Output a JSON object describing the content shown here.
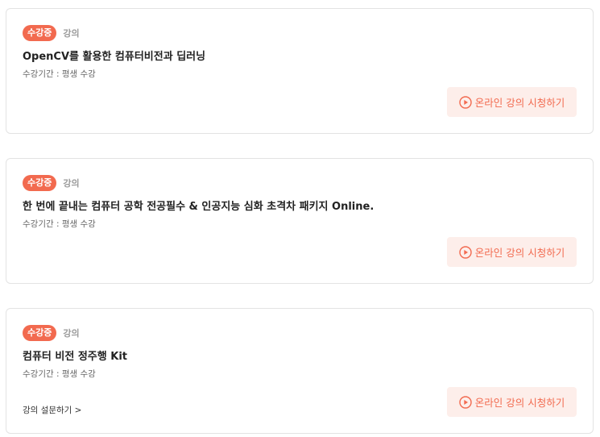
{
  "courses": [
    {
      "badge": "수강중",
      "type": "강의",
      "title": "OpenCV를 활용한 컴퓨터비전과 딥러닝",
      "period": "수강기간 : 평생 수강",
      "watch_label": "온라인 강의 시청하기"
    },
    {
      "badge": "수강중",
      "type": "강의",
      "title": "한 번에 끝내는 컴퓨터 공학 전공필수 & 인공지능 심화 초격차 패키지 Online.",
      "period": "수강기간 : 평생 수강",
      "watch_label": "온라인 강의 시청하기"
    },
    {
      "badge": "수강중",
      "type": "강의",
      "title": "컴퓨터 비전 정주행 Kit",
      "period": "수강기간 : 평생 수강",
      "watch_label": "온라인 강의 시청하기",
      "survey_label": "강의 설문하기 >"
    }
  ],
  "colors": {
    "accent": "#f26a4f",
    "button_bg": "#fdeeea"
  },
  "icons": {
    "watch": "play-circle-icon"
  }
}
